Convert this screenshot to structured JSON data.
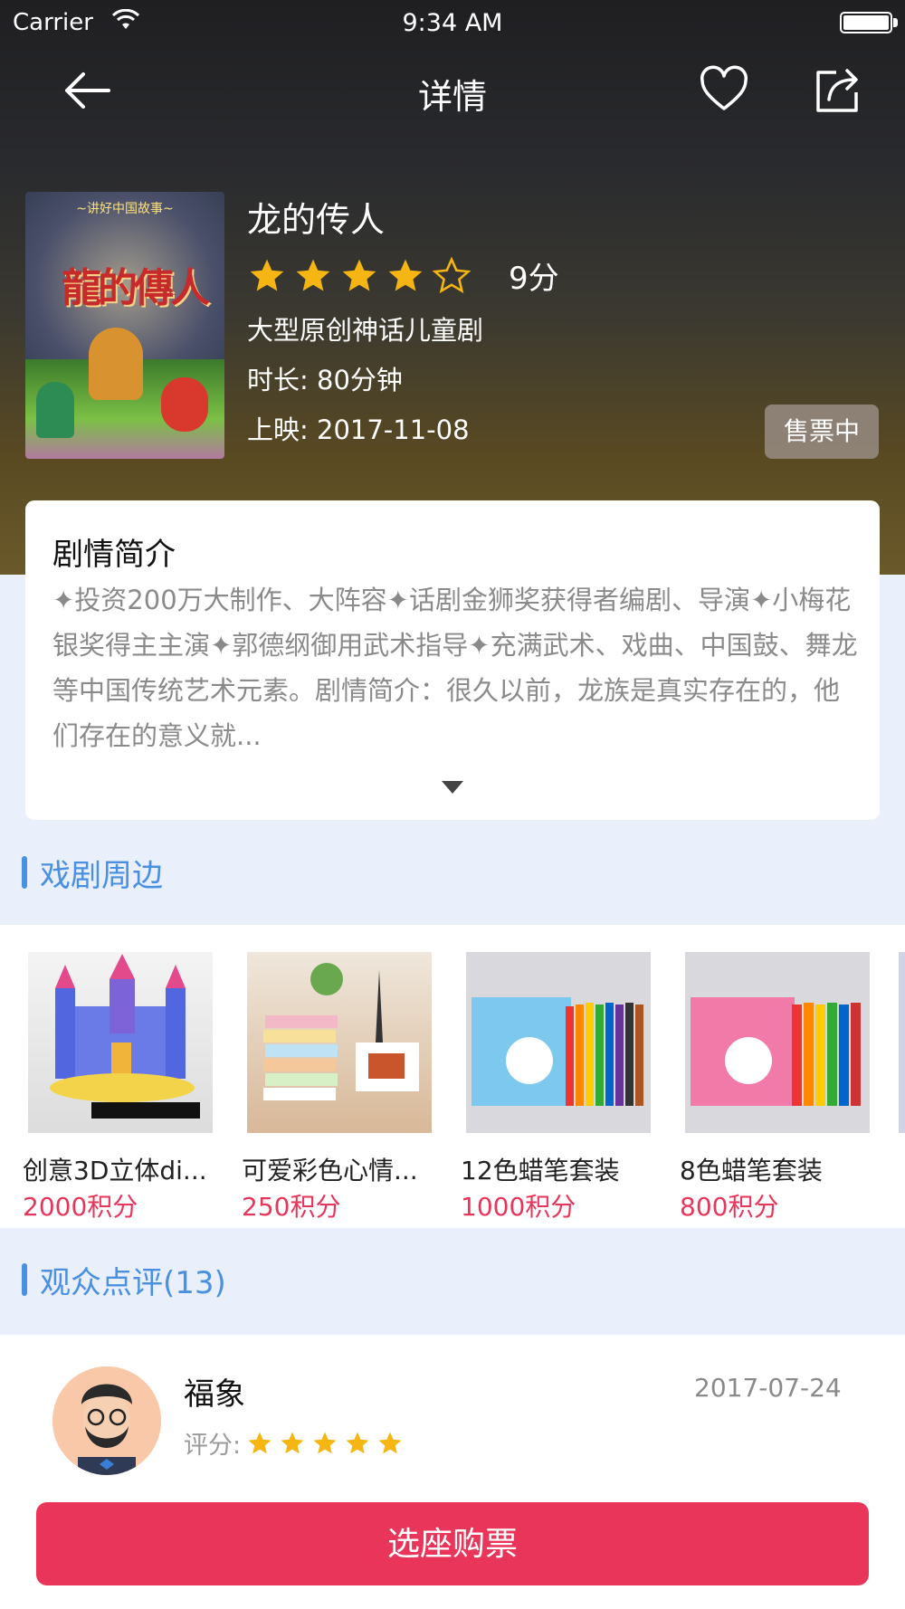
{
  "status_bar": {
    "carrier": "Carrier",
    "time": "9:34 AM"
  },
  "nav": {
    "title": "详情"
  },
  "show": {
    "title": "龙的传人",
    "rating_stars": 4,
    "rating_max": 5,
    "score": "9分",
    "genre": "大型原创神话儿童剧",
    "duration": "时长: 80分钟",
    "release": "上映: 2017-11-08",
    "status": "售票中",
    "poster_top_text": "~讲好中国故事~",
    "poster_title": "龍的傳人"
  },
  "synopsis": {
    "title": "剧情简介",
    "body": "✦投资200万大制作、大阵容✦话剧金狮奖获得者编剧、导演✦小梅花银奖得主主演✦郭德纲御用武术指导✦充满武术、戏曲、中国鼓、舞龙等中国传统艺术元素。剧情简介：很久以前，龙族是真实存在的，他们存在的意义就..."
  },
  "merch_section": {
    "title": "戏剧周边",
    "items": [
      {
        "name": "创意3D立体di...",
        "points": "2000积分"
      },
      {
        "name": "可爱彩色心情...",
        "points": "250积分"
      },
      {
        "name": "12色蜡笔套装",
        "points": "1000积分"
      },
      {
        "name": "8色蜡笔套装",
        "points": "800积分"
      }
    ]
  },
  "reviews_section": {
    "title": "观众点评(13)",
    "items": [
      {
        "name": "福象",
        "date": "2017-07-24",
        "rating_label": "评分:",
        "stars": 5
      }
    ]
  },
  "buy_button": {
    "label": "选座购票"
  },
  "colors": {
    "accent": "#ea355a",
    "section_blue": "#4a90e2",
    "star": "#f5b614"
  }
}
